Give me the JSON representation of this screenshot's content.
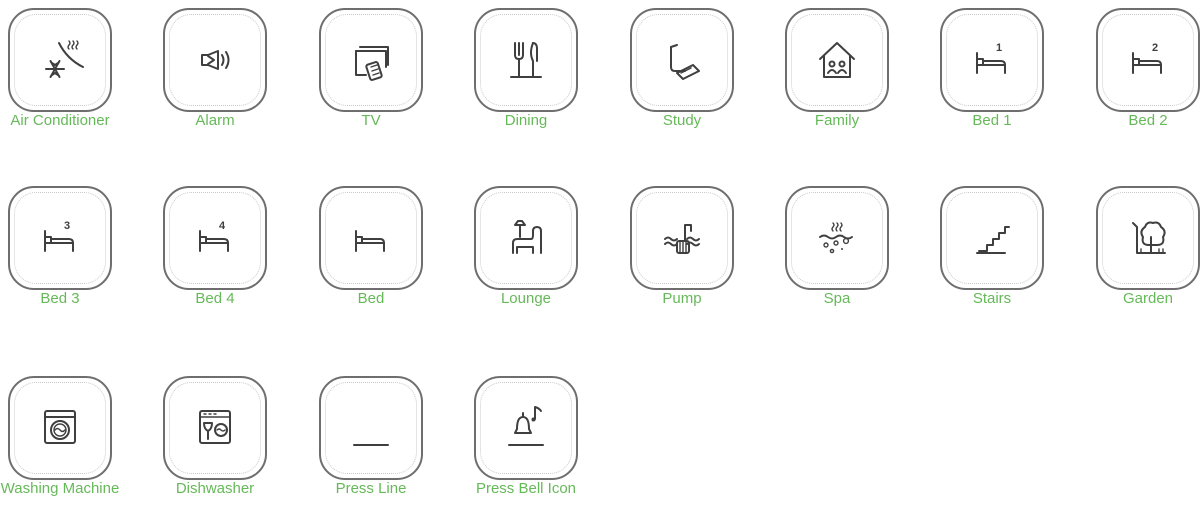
{
  "tiles": [
    {
      "label": "Air Conditioner",
      "icon": "air-conditioner-icon"
    },
    {
      "label": "Alarm",
      "icon": "alarm-icon"
    },
    {
      "label": "TV",
      "icon": "tv-icon"
    },
    {
      "label": "Dining",
      "icon": "dining-icon"
    },
    {
      "label": "Study",
      "icon": "study-icon"
    },
    {
      "label": "Family",
      "icon": "family-icon"
    },
    {
      "label": "Bed 1",
      "icon": "bed-1-icon",
      "badge": "1"
    },
    {
      "label": "Bed 2",
      "icon": "bed-2-icon",
      "badge": "2"
    },
    {
      "label": "Bed 3",
      "icon": "bed-3-icon",
      "badge": "3"
    },
    {
      "label": "Bed 4",
      "icon": "bed-4-icon",
      "badge": "4"
    },
    {
      "label": "Bed",
      "icon": "bed-icon"
    },
    {
      "label": "Lounge",
      "icon": "lounge-icon"
    },
    {
      "label": "Pump",
      "icon": "pump-icon"
    },
    {
      "label": "Spa",
      "icon": "spa-icon"
    },
    {
      "label": "Stairs",
      "icon": "stairs-icon"
    },
    {
      "label": "Garden",
      "icon": "garden-icon"
    },
    {
      "label": "Washing Machine",
      "icon": "washing-machine-icon"
    },
    {
      "label": "Dishwasher",
      "icon": "dishwasher-icon"
    },
    {
      "label": "Press Line",
      "icon": "press-line-icon"
    },
    {
      "label": "Press Bell Icon",
      "icon": "press-bell-icon"
    }
  ],
  "colors": {
    "label": "#66b959",
    "border": "#6e6e6e",
    "icon": "#3f3f3f"
  }
}
